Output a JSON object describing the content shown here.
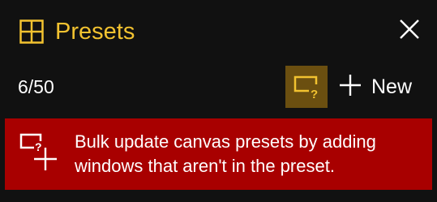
{
  "header": {
    "icon": "grid-layout-icon",
    "title": "Presets",
    "close_icon": "close-icon"
  },
  "toolbar": {
    "count": "6/50",
    "help_icon": "window-question-icon",
    "new_icon": "plus-icon",
    "new_label": "New"
  },
  "banner": {
    "icon": "window-add-icon",
    "message": "Bulk update canvas presets by adding windows that aren't in the preset."
  },
  "colors": {
    "accent": "#f2c230",
    "background": "#111111",
    "help_button_bg": "#6b4f10",
    "banner_bg": "#a80000",
    "text": "#ffffff"
  }
}
